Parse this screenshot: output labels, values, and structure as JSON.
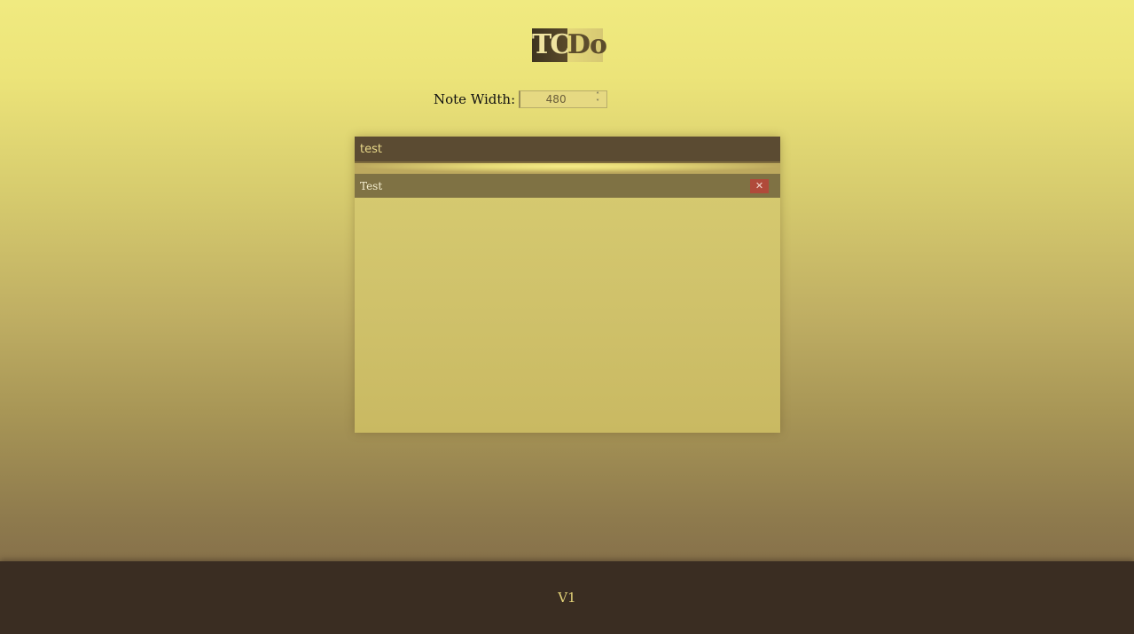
{
  "logo": {
    "part_a": "TC",
    "part_b": "Do"
  },
  "controls": {
    "note_width_label": "Note Width:",
    "note_width_value": "480"
  },
  "note": {
    "title": "test",
    "items": [
      {
        "label": "Test",
        "delete_glyph": "✕"
      }
    ]
  },
  "footer": {
    "version": "V1"
  },
  "colors": {
    "header_bg": "#5b4b32",
    "item_bg": "#7f7244",
    "delete_bg": "#b04a3a",
    "footer_bg": "#3a2d22"
  }
}
